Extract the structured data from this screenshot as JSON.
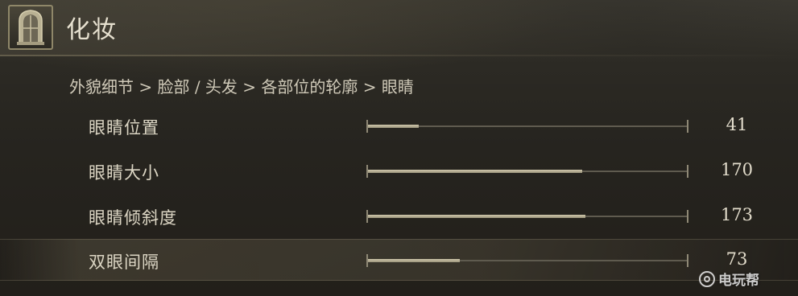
{
  "header": {
    "title": "化妆",
    "emblem_icon": "cathedral-window-icon"
  },
  "breadcrumb": "外貌细节 > 脸部 / 头发 > 各部位的轮廓 > 眼睛",
  "sliders": [
    {
      "label": "眼睛位置",
      "value": "41",
      "fraction": 0.16
    },
    {
      "label": "眼睛大小",
      "value": "170",
      "fraction": 0.67
    },
    {
      "label": "眼睛倾斜度",
      "value": "173",
      "fraction": 0.68
    },
    {
      "label": "双眼间隔",
      "value": "73",
      "fraction": 0.29,
      "selected": true
    }
  ],
  "watermark": {
    "text": "电玩帮",
    "icon": "gamepad-logo-icon"
  },
  "colors": {
    "accent": "#cfc7ab",
    "track": "#5f5b4f",
    "text": "#dcd6c4"
  }
}
